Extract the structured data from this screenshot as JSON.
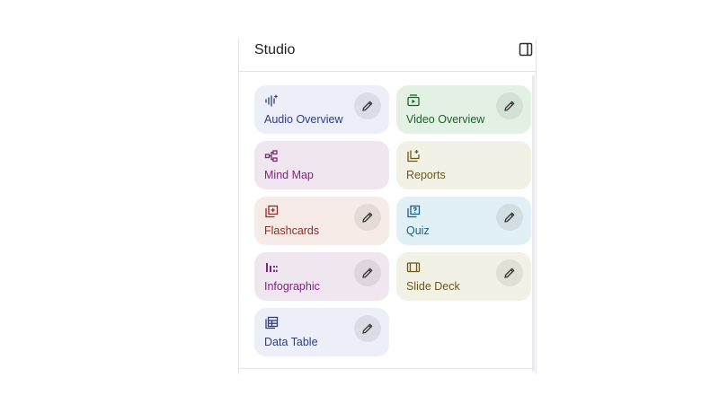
{
  "studio": {
    "title": "Studio",
    "toggle_icon": "side-panel-icon"
  },
  "tiles": [
    {
      "key": "audio",
      "label": "Audio Overview",
      "icon": "audio-waveform-sparkle-icon",
      "bg": "#eceef8",
      "fg": "#2f3e7d",
      "editable": true
    },
    {
      "key": "video",
      "label": "Video Overview",
      "icon": "video-stack-icon",
      "bg": "#e3f1e5",
      "fg": "#1f5f2a",
      "editable": true
    },
    {
      "key": "mindmap",
      "label": "Mind Map",
      "icon": "mind-map-icon",
      "bg": "#f0e6ef",
      "fg": "#7a2a7a",
      "editable": false
    },
    {
      "key": "reports",
      "label": "Reports",
      "icon": "report-add-icon",
      "bg": "#f2f1e6",
      "fg": "#6b5a1e",
      "editable": false
    },
    {
      "key": "flashcards",
      "label": "Flashcards",
      "icon": "flashcards-icon",
      "bg": "#f6ebe7",
      "fg": "#8b2f28",
      "editable": true
    },
    {
      "key": "quiz",
      "label": "Quiz",
      "icon": "quiz-icon",
      "bg": "#e1f0f5",
      "fg": "#1e5f87",
      "editable": true
    },
    {
      "key": "infographic",
      "label": "Infographic",
      "icon": "infographic-icon",
      "bg": "#f0e6ef",
      "fg": "#7a2a7a",
      "editable": true
    },
    {
      "key": "slidedeck",
      "label": "Slide Deck",
      "icon": "slide-deck-icon",
      "bg": "#f2f1e6",
      "fg": "#6b5a1e",
      "editable": true
    },
    {
      "key": "datatable",
      "label": "Data Table",
      "icon": "data-table-icon",
      "bg": "#eceef8",
      "fg": "#2f3e7d",
      "editable": true
    }
  ],
  "edit_icon": "pencil-icon"
}
